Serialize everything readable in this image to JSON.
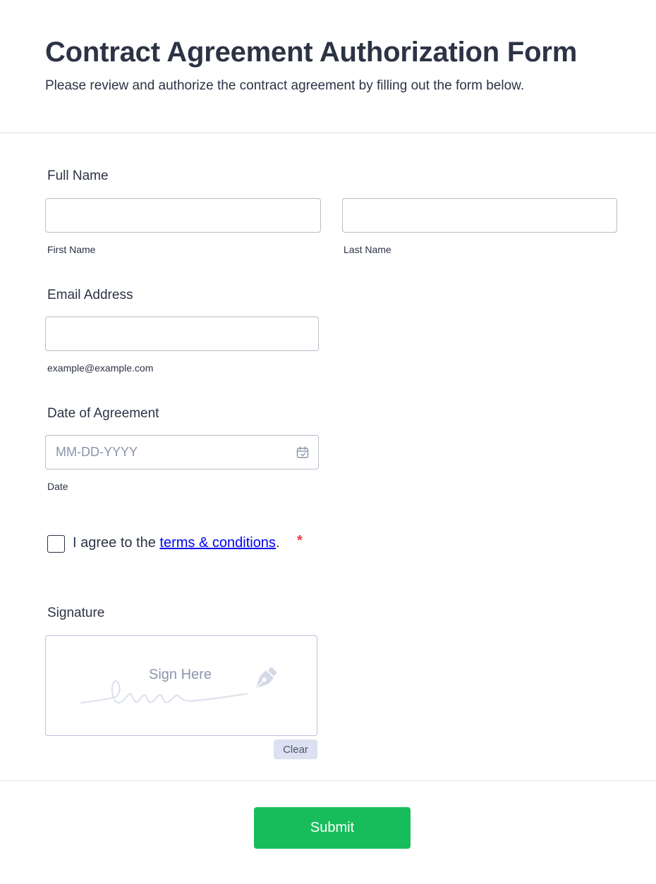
{
  "header": {
    "title": "Contract Agreement Authorization Form",
    "subtitle": "Please review and authorize the contract agreement by filling out the form below."
  },
  "full_name": {
    "label": "Full Name",
    "first_sublabel": "First Name",
    "last_sublabel": "Last Name",
    "first_value": "",
    "last_value": ""
  },
  "email": {
    "label": "Email Address",
    "sublabel": "example@example.com",
    "value": ""
  },
  "date": {
    "label": "Date of Agreement",
    "placeholder": "MM-DD-YYYY",
    "sublabel": "Date"
  },
  "terms": {
    "prefix": "I agree to the ",
    "link_text": "terms & conditions",
    "suffix": ".",
    "required_mark": "*"
  },
  "signature": {
    "label": "Signature",
    "placeholder": "Sign Here",
    "clear_label": "Clear"
  },
  "submit_label": "Submit",
  "colors": {
    "text": "#2c3345",
    "submit": "#18bd5b",
    "required": "#f23a3c",
    "link": "#0000ee",
    "clear_bg": "#dbe1f0"
  }
}
